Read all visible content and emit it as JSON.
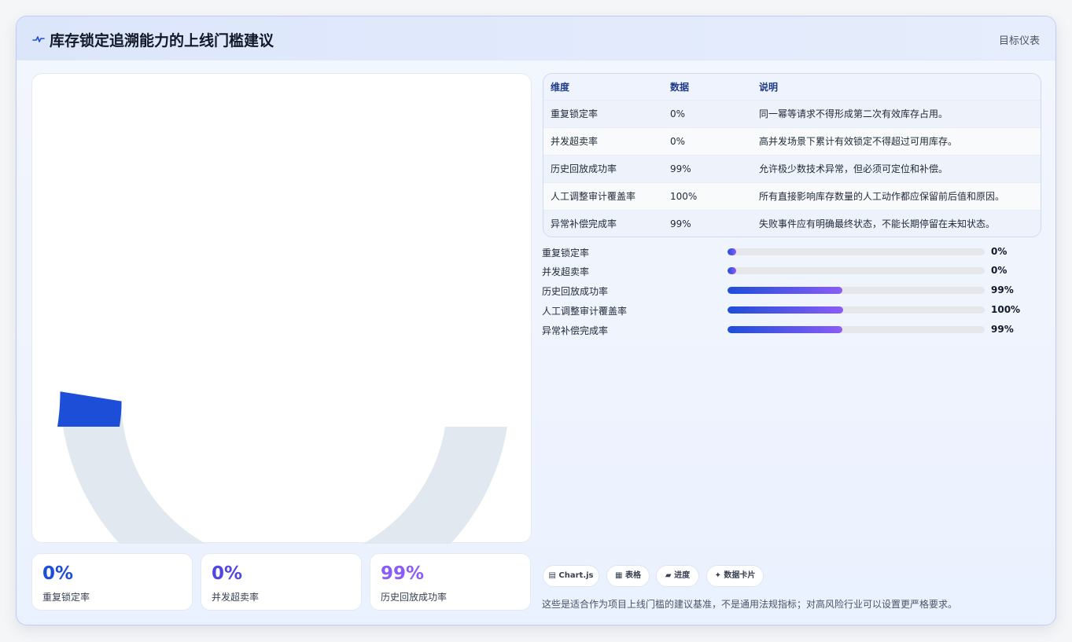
{
  "header": {
    "title": "库存锁定追溯能力的上线门槛建议",
    "tag": "目标仪表"
  },
  "gauge": {
    "value": 0,
    "max": 100,
    "min": 0,
    "fill_color": "#1d4ed8",
    "track_color": "#e2e8f0"
  },
  "stats": [
    {
      "value": "0%",
      "label": "重复锁定率",
      "color": "#1d4ed8"
    },
    {
      "value": "0%",
      "label": "并发超卖率",
      "color": "#4f46e5"
    },
    {
      "value": "99%",
      "label": "历史回放成功率",
      "color": "#8b5cf6"
    }
  ],
  "table": {
    "headers": [
      "维度",
      "数据",
      "说明"
    ],
    "rows": [
      [
        "重复锁定率",
        "0%",
        "同一幂等请求不得形成第二次有效库存占用。"
      ],
      [
        "并发超卖率",
        "0%",
        "高并发场景下累计有效锁定不得超过可用库存。"
      ],
      [
        "历史回放成功率",
        "99%",
        "允许极少数技术异常，但必须可定位和补偿。"
      ],
      [
        "人工调整审计覆盖率",
        "100%",
        "所有直接影响库存数量的人工动作都应保留前后值和原因。"
      ],
      [
        "异常补偿完成率",
        "99%",
        "失败事件应有明确最终状态，不能长期停留在未知状态。"
      ]
    ]
  },
  "bars": [
    {
      "label": "重复锁定率",
      "value": 0,
      "display": "0%"
    },
    {
      "label": "并发超卖率",
      "value": 0,
      "display": "0%"
    },
    {
      "label": "历史回放成功率",
      "value": 99,
      "display": "99%"
    },
    {
      "label": "人工调整审计覆盖率",
      "value": 100,
      "display": "100%"
    },
    {
      "label": "异常补偿完成率",
      "value": 99,
      "display": "99%"
    }
  ],
  "chips": [
    {
      "icon": "chart-icon",
      "label": "▤ Chart.js"
    },
    {
      "icon": "table-icon",
      "label": "▦ 表格"
    },
    {
      "icon": "progress-icon",
      "label": "▰ 进度"
    },
    {
      "icon": "card-icon",
      "label": "✦ 数据卡片"
    }
  ],
  "note": "这些是适合作为项目上线门槛的建议基准，不是通用法规指标；对高风险行业可以设置更严格要求。"
}
